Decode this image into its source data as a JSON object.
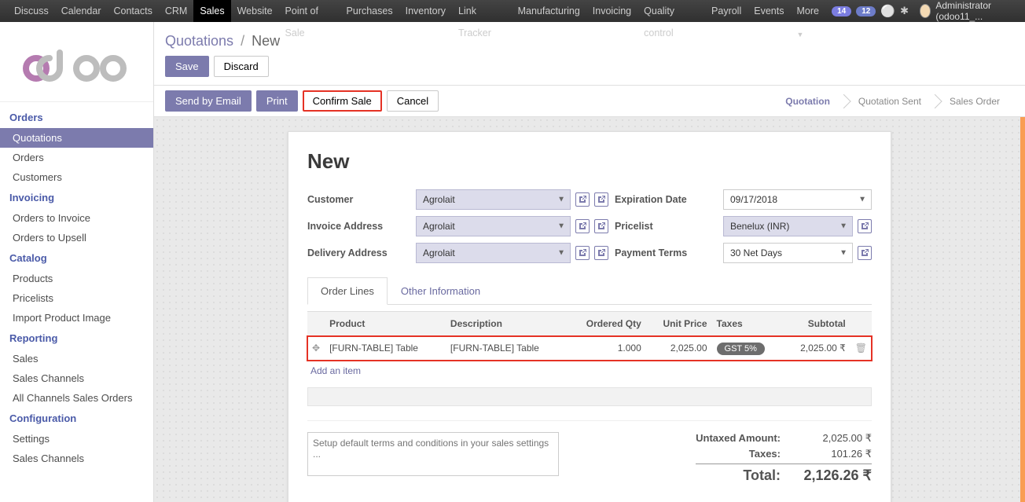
{
  "topnav": {
    "items": [
      "Discuss",
      "Calendar",
      "Contacts",
      "CRM",
      "Sales",
      "Website",
      "Point of Sale",
      "Purchases",
      "Inventory",
      "Link Tracker",
      "Manufacturing",
      "Invoicing",
      "Quality control",
      "Payroll",
      "Events",
      "More"
    ],
    "active_index": 4,
    "badge1": "14",
    "badge2": "12",
    "user": "Administrator (odoo11_..."
  },
  "sidebar": {
    "groups": [
      {
        "title": "Orders",
        "items": [
          "Quotations",
          "Orders",
          "Customers"
        ],
        "selected": 0
      },
      {
        "title": "Invoicing",
        "items": [
          "Orders to Invoice",
          "Orders to Upsell"
        ],
        "selected": -1
      },
      {
        "title": "Catalog",
        "items": [
          "Products",
          "Pricelists",
          "Import Product Image"
        ],
        "selected": -1
      },
      {
        "title": "Reporting",
        "items": [
          "Sales",
          "Sales Channels",
          "All Channels Sales Orders"
        ],
        "selected": -1
      },
      {
        "title": "Configuration",
        "items": [
          "Settings",
          "Sales Channels"
        ],
        "selected": -1
      }
    ]
  },
  "breadcrumb": {
    "parent": "Quotations",
    "current": "New"
  },
  "buttons": {
    "save": "Save",
    "discard": "Discard",
    "send_email": "Send by Email",
    "print": "Print",
    "confirm_sale": "Confirm Sale",
    "cancel": "Cancel"
  },
  "status_steps": [
    "Quotation",
    "Quotation Sent",
    "Sales Order"
  ],
  "form": {
    "title": "New",
    "fields": {
      "customer": {
        "label": "Customer",
        "value": "Agrolait"
      },
      "invoice_address": {
        "label": "Invoice Address",
        "value": "Agrolait"
      },
      "delivery_address": {
        "label": "Delivery Address",
        "value": "Agrolait"
      },
      "expiration": {
        "label": "Expiration Date",
        "value": "09/17/2018"
      },
      "pricelist": {
        "label": "Pricelist",
        "value": "Benelux (INR)"
      },
      "payment_terms": {
        "label": "Payment Terms",
        "value": "30 Net Days"
      }
    },
    "tabs": [
      "Order Lines",
      "Other Information"
    ],
    "table": {
      "headers": [
        "Product",
        "Description",
        "Ordered Qty",
        "Unit Price",
        "Taxes",
        "Subtotal"
      ],
      "rows": [
        {
          "product": "[FURN-TABLE] Table",
          "description": "[FURN-TABLE] Table",
          "qty": "1.000",
          "price": "2,025.00",
          "tax": "GST 5%",
          "subtotal": "2,025.00 ₹"
        }
      ],
      "add_line": "Add an item"
    },
    "terms_placeholder": "Setup default terms and conditions in your sales settings ...",
    "totals": {
      "untaxed_label": "Untaxed Amount:",
      "untaxed": "2,025.00 ₹",
      "taxes_label": "Taxes:",
      "taxes": "101.26 ₹",
      "total_label": "Total:",
      "total": "2,126.26 ₹"
    }
  }
}
